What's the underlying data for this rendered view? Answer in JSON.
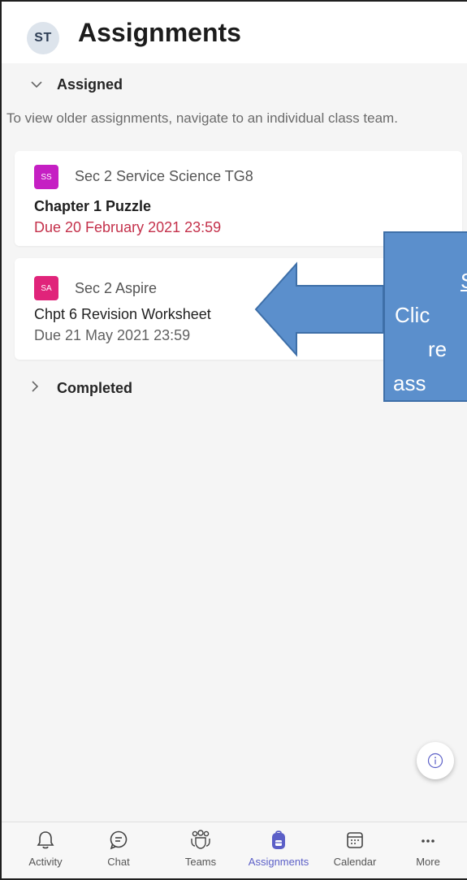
{
  "header": {
    "avatar_initials": "ST",
    "title": "Assignments"
  },
  "assigned_section": {
    "label": "Assigned",
    "hint": "To view older assignments, navigate to an individual class team."
  },
  "assignments": [
    {
      "badge": "SS",
      "badge_color": "#c51fc3",
      "class_name": "Sec 2 Service Science TG8",
      "title": "Chapter 1 Puzzle",
      "due": "Due 20 February 2021 23:59",
      "due_color": "#c4314b"
    },
    {
      "badge": "SA",
      "badge_color": "#e0247a",
      "class_name": "Sec 2 Aspire",
      "title": "Chpt 6 Revision Worksheet",
      "due": "Due 21 May 2021 23:59",
      "due_color": "#616161"
    }
  ],
  "completed_section": {
    "label": "Completed"
  },
  "callout": {
    "line1": "S",
    "line2": "Clic",
    "line3": "re",
    "line4": "ass"
  },
  "nav": [
    {
      "label": "Activity",
      "icon": "bell-icon"
    },
    {
      "label": "Chat",
      "icon": "chat-icon"
    },
    {
      "label": "Teams",
      "icon": "teams-icon"
    },
    {
      "label": "Assignments",
      "icon": "backpack-icon",
      "active": true
    },
    {
      "label": "Calendar",
      "icon": "calendar-icon"
    },
    {
      "label": "More",
      "icon": "more-icon"
    }
  ],
  "colors": {
    "accent": "#5b5fc7",
    "callout": "#5b8fcc"
  }
}
